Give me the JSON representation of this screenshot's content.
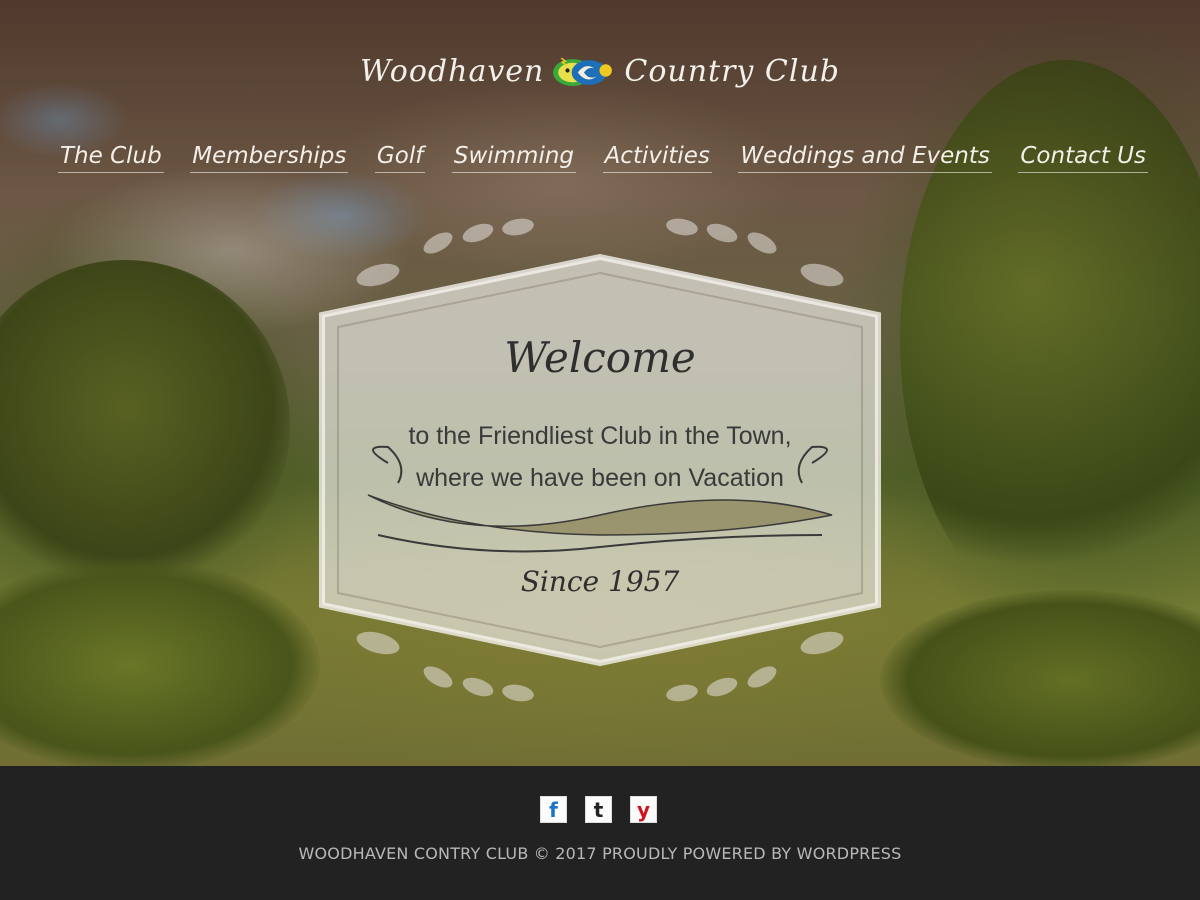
{
  "site": {
    "logo_left_text": "Woodhaven",
    "logo_right_text": "Country Club"
  },
  "nav": {
    "items": [
      {
        "label": "The Club"
      },
      {
        "label": "Memberships"
      },
      {
        "label": "Golf"
      },
      {
        "label": "Swimming"
      },
      {
        "label": "Activities"
      },
      {
        "label": "Weddings and Events"
      },
      {
        "label": "Contact Us"
      }
    ]
  },
  "hero": {
    "welcome": "Welcome",
    "tagline_line1": "to the Friendliest Club in the Town,",
    "tagline_line2": "where we have been on Vacation",
    "since": "Since 1957"
  },
  "footer": {
    "social": [
      {
        "icon": "facebook-icon",
        "glyph": "f",
        "color": "#1a73c8"
      },
      {
        "icon": "tumblr-icon",
        "glyph": "t",
        "color": "#222222"
      },
      {
        "icon": "yelp-icon",
        "glyph": "y",
        "color": "#d0121a"
      }
    ],
    "copyright": "WOODHAVEN CONTRY CLUB © 2017 PROUDLY POWERED BY WORDPRESS"
  },
  "colors": {
    "nav_text": "#f3efe8",
    "footer_bg": "#222222",
    "footer_text": "#b8b8b8"
  }
}
